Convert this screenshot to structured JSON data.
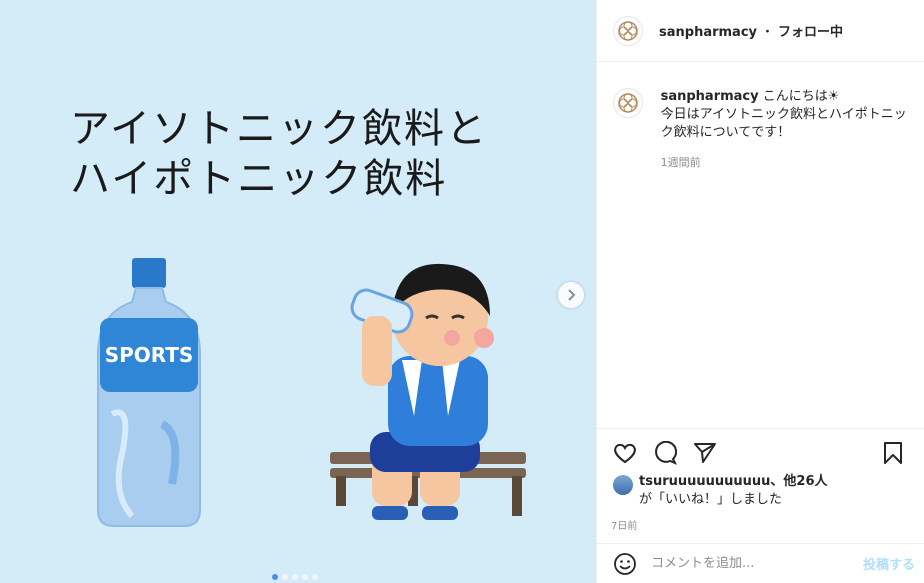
{
  "post_image": {
    "headline_line1": "アイソトニック飲料と",
    "headline_line2": "ハイポトニック飲料",
    "bottle_label": "SPORTS",
    "slide_count": 5,
    "active_slide": 1
  },
  "header": {
    "username": "sanpharmacy",
    "separator": "・",
    "follow_status": "フォロー中"
  },
  "caption": {
    "username": "sanpharmacy",
    "text_line1": "こんにちは☀",
    "text_line2": "今日はアイソトニック飲料とハイポトニック飲料についてです！",
    "time": "1週間前"
  },
  "likes": {
    "liker": "tsuruuuuuuuuuuu",
    "others": "、他26人",
    "suffix": "が「いいね！」しました"
  },
  "post_time": "7日前",
  "comment": {
    "placeholder": "コメントを追加...",
    "post_label": "投稿する"
  },
  "colors": {
    "image_bg": "#d4ebf8",
    "post_button": "#b2dffc",
    "bottle": "#5aa0e0"
  }
}
